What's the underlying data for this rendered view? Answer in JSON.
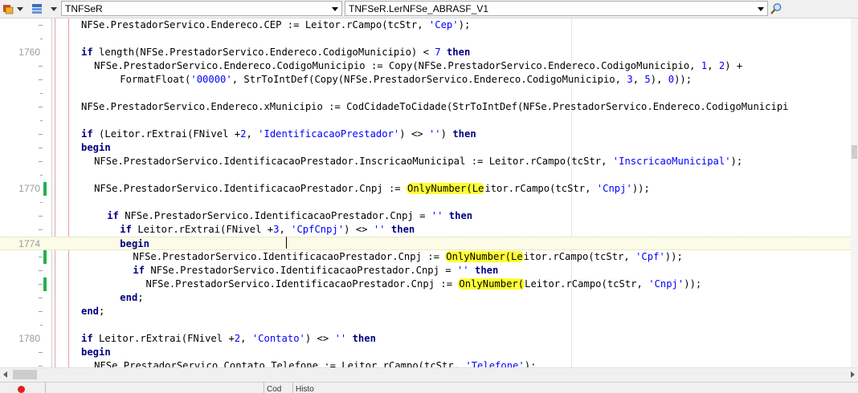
{
  "toolbar": {
    "class_combo": "TNFSeR",
    "method_combo": "TNFSeR.LerNFSe_ABRASF_V1"
  },
  "editor": {
    "lines": [
      {
        "num": "",
        "indent": 6,
        "mark": "",
        "changed": false,
        "tokens": [
          [
            "t",
            "NFSe.PrestadorServico.Endereco.CEP := Leitor.rCampo(tcStr, "
          ],
          [
            "s",
            "'Cep'"
          ],
          [
            "t",
            ");"
          ]
        ]
      },
      {
        "num": "",
        "indent": 0,
        "mark": "short",
        "changed": false,
        "tokens": []
      },
      {
        "num": "1760",
        "indent": 6,
        "mark": "",
        "changed": false,
        "tokens": [
          [
            "k",
            "if"
          ],
          [
            "t",
            " length(NFSe.PrestadorServico.Endereco.CodigoMunicipio) < "
          ],
          [
            "n",
            "7"
          ],
          [
            "t",
            " "
          ],
          [
            "k",
            "then"
          ]
        ]
      },
      {
        "num": "",
        "indent": 8,
        "mark": "",
        "changed": false,
        "tokens": [
          [
            "t",
            "NFSe.PrestadorServico.Endereco.CodigoMunicipio := Copy(NFSe.PrestadorServico.Endereco.CodigoMunicipio, "
          ],
          [
            "n",
            "1"
          ],
          [
            "t",
            ", "
          ],
          [
            "n",
            "2"
          ],
          [
            "t",
            ") +"
          ]
        ]
      },
      {
        "num": "",
        "indent": 12,
        "mark": "",
        "changed": false,
        "tokens": [
          [
            "t",
            "FormatFloat("
          ],
          [
            "s",
            "'00000'"
          ],
          [
            "t",
            ", StrToIntDef(Copy(NFSe.PrestadorServico.Endereco.CodigoMunicipio, "
          ],
          [
            "n",
            "3"
          ],
          [
            "t",
            ", "
          ],
          [
            "n",
            "5"
          ],
          [
            "t",
            "), "
          ],
          [
            "n",
            "0"
          ],
          [
            "t",
            "));"
          ]
        ]
      },
      {
        "num": "",
        "indent": 0,
        "mark": "short",
        "changed": false,
        "tokens": []
      },
      {
        "num": "",
        "indent": 6,
        "mark": "",
        "changed": false,
        "tokens": [
          [
            "t",
            "NFSe.PrestadorServico.Endereco.xMunicipio := CodCidadeToCidade(StrToIntDef(NFSe.PrestadorServico.Endereco.CodigoMunicipi"
          ]
        ]
      },
      {
        "num": "",
        "indent": 0,
        "mark": "short",
        "changed": false,
        "tokens": []
      },
      {
        "num": "",
        "indent": 6,
        "mark": "",
        "changed": false,
        "tokens": [
          [
            "k",
            "if"
          ],
          [
            "t",
            " (Leitor.rExtrai(FNivel +"
          ],
          [
            "n",
            "2"
          ],
          [
            "t",
            ", "
          ],
          [
            "s",
            "'IdentificacaoPrestador'"
          ],
          [
            "t",
            ") <> "
          ],
          [
            "s",
            "''"
          ],
          [
            "t",
            ") "
          ],
          [
            "k",
            "then"
          ]
        ]
      },
      {
        "num": "",
        "indent": 6,
        "mark": "",
        "changed": false,
        "tokens": [
          [
            "k",
            "begin"
          ]
        ]
      },
      {
        "num": "",
        "indent": 8,
        "mark": "",
        "changed": false,
        "tokens": [
          [
            "t",
            "NFSe.PrestadorServico.IdentificacaoPrestador.InscricaoMunicipal := Leitor.rCampo(tcStr, "
          ],
          [
            "s",
            "'InscricaoMunicipal'"
          ],
          [
            "t",
            ");"
          ]
        ]
      },
      {
        "num": "",
        "indent": 0,
        "mark": "short",
        "changed": false,
        "tokens": []
      },
      {
        "num": "1770",
        "indent": 8,
        "mark": "",
        "changed": true,
        "tokens": [
          [
            "t",
            "NFSe.PrestadorServico.IdentificacaoPrestador.Cnpj := "
          ],
          [
            "h",
            "OnlyNumber(Le"
          ],
          [
            "t",
            "itor.rCampo(tcStr, "
          ],
          [
            "s",
            "'Cnpj'"
          ],
          [
            "t",
            "));"
          ]
        ]
      },
      {
        "num": "",
        "indent": 0,
        "mark": "short",
        "changed": false,
        "tokens": []
      },
      {
        "num": "",
        "indent": 10,
        "mark": "",
        "changed": false,
        "tokens": [
          [
            "k",
            "if"
          ],
          [
            "t",
            " NFSe.PrestadorServico.IdentificacaoPrestador.Cnpj = "
          ],
          [
            "s",
            "''"
          ],
          [
            "t",
            " "
          ],
          [
            "k",
            "then"
          ]
        ]
      },
      {
        "num": "",
        "indent": 12,
        "mark": "",
        "changed": false,
        "tokens": [
          [
            "k",
            "if"
          ],
          [
            "t",
            " Leitor.rExtrai(FNivel +"
          ],
          [
            "n",
            "3"
          ],
          [
            "t",
            ", "
          ],
          [
            "s",
            "'CpfCnpj'"
          ],
          [
            "t",
            ") <> "
          ],
          [
            "s",
            "''"
          ],
          [
            "t",
            " "
          ],
          [
            "k",
            "then"
          ]
        ]
      },
      {
        "num": "1774",
        "indent": 12,
        "mark": "",
        "changed": false,
        "current": true,
        "tokens": [
          [
            "k",
            "begin"
          ]
        ]
      },
      {
        "num": "",
        "indent": 14,
        "mark": "",
        "changed": true,
        "tokens": [
          [
            "t",
            "NFSe.PrestadorServico.IdentificacaoPrestador.Cnpj := "
          ],
          [
            "h",
            "OnlyNumber(Le"
          ],
          [
            "t",
            "itor.rCampo(tcStr, "
          ],
          [
            "s",
            "'Cpf'"
          ],
          [
            "t",
            "));"
          ]
        ]
      },
      {
        "num": "",
        "indent": 14,
        "mark": "",
        "changed": false,
        "tokens": [
          [
            "k",
            "if"
          ],
          [
            "t",
            " NFSe.PrestadorServico.IdentificacaoPrestador.Cnpj = "
          ],
          [
            "s",
            "''"
          ],
          [
            "t",
            " "
          ],
          [
            "k",
            "then"
          ]
        ]
      },
      {
        "num": "",
        "indent": 16,
        "mark": "",
        "changed": true,
        "tokens": [
          [
            "t",
            "NFSe.PrestadorServico.IdentificacaoPrestador.Cnpj := "
          ],
          [
            "h",
            "OnlyNumber("
          ],
          [
            "t",
            "Leitor.rCampo(tcStr, "
          ],
          [
            "s",
            "'Cnpj'"
          ],
          [
            "t",
            "));"
          ]
        ]
      },
      {
        "num": "",
        "indent": 12,
        "mark": "",
        "changed": false,
        "tokens": [
          [
            "k",
            "end"
          ],
          [
            "t",
            ";"
          ]
        ]
      },
      {
        "num": "",
        "indent": 6,
        "mark": "",
        "changed": false,
        "tokens": [
          [
            "k",
            "end"
          ],
          [
            "t",
            ";"
          ]
        ]
      },
      {
        "num": "",
        "indent": 0,
        "mark": "short",
        "changed": false,
        "tokens": []
      },
      {
        "num": "1780",
        "indent": 6,
        "mark": "",
        "changed": false,
        "tokens": [
          [
            "k",
            "if"
          ],
          [
            "t",
            " Leitor.rExtrai(FNivel +"
          ],
          [
            "n",
            "2"
          ],
          [
            "t",
            ", "
          ],
          [
            "s",
            "'Contato'"
          ],
          [
            "t",
            ") <> "
          ],
          [
            "s",
            "''"
          ],
          [
            "t",
            " "
          ],
          [
            "k",
            "then"
          ]
        ]
      },
      {
        "num": "",
        "indent": 6,
        "mark": "",
        "changed": false,
        "tokens": [
          [
            "k",
            "begin"
          ]
        ]
      },
      {
        "num": "",
        "indent": 8,
        "mark": "",
        "changed": false,
        "tokens": [
          [
            "t",
            "NFSe.PrestadorServico.Contato.Telefone := Leitor.rCampo(tcStr, "
          ],
          [
            "s",
            "'Telefone'"
          ],
          [
            "t",
            "):"
          ]
        ]
      }
    ]
  },
  "colors": {
    "keyword": "#000080",
    "string": "#0000ff",
    "highlight": "#ffff33",
    "changed_marker": "#22b14c"
  },
  "bottom": {
    "tab1": "",
    "tab2": "Cod",
    "tab3": "Histo"
  }
}
